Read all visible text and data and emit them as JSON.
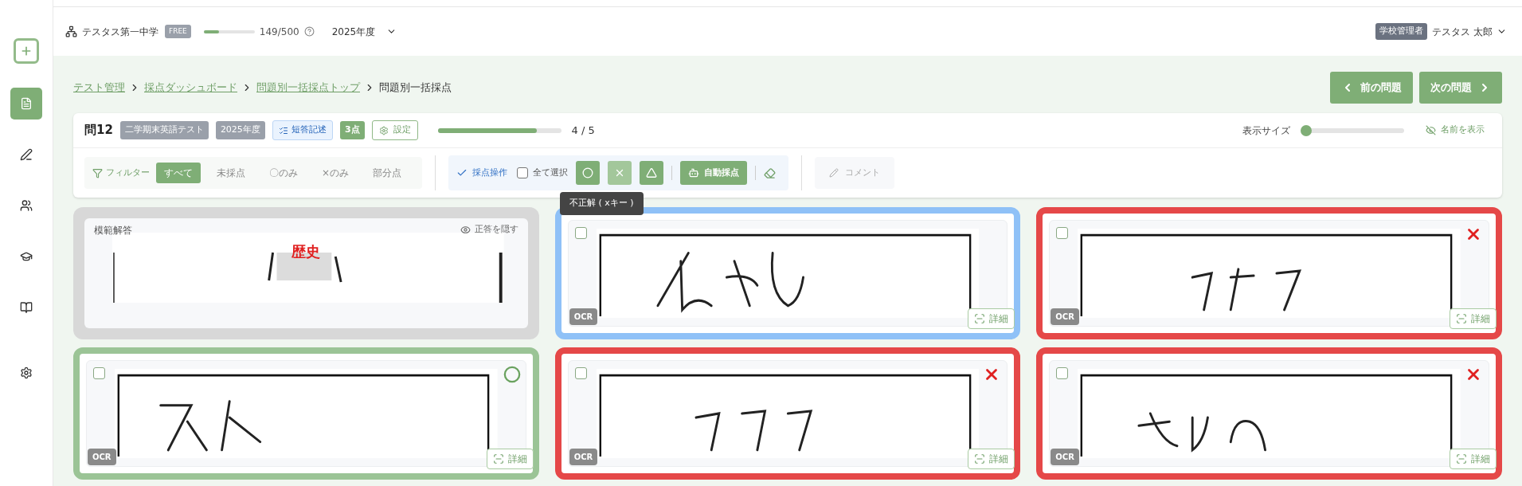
{
  "sidebar": {
    "add_button": {
      "selected": false
    },
    "items": [
      {
        "selected": true
      },
      {
        "selected": false
      },
      {
        "selected": false
      },
      {
        "selected": false
      },
      {
        "selected": false
      },
      {
        "selected": false
      }
    ]
  },
  "header": {
    "school": "テスタス第一中学",
    "plan": "FREE",
    "quota": {
      "level": 0.3,
      "reading": "149/500"
    },
    "year": "2025年度",
    "role": "学校管理者",
    "user": "テスタス 太郎"
  },
  "breadcrumbs": [
    {
      "label": "テスト管理",
      "link": true
    },
    {
      "label": "採点ダッシュボード",
      "link": true
    },
    {
      "label": "問題別一括採点トップ",
      "link": true
    },
    {
      "label": "問題別一括採点",
      "link": false
    }
  ],
  "nav_buttons": {
    "prev": "前の問題",
    "next": "次の問題"
  },
  "question": {
    "title": "問12",
    "tags": [
      "二学期末英語テスト",
      "2025年度"
    ],
    "type": "短答記述",
    "points": "3点",
    "settings": "設定",
    "progress": {
      "level": 0.8,
      "reading": "4 / 5"
    },
    "display_size": {
      "label": "表示サイズ",
      "level": 0
    },
    "show_names": "名前を表示"
  },
  "filter": {
    "label": "フィルター",
    "options": [
      {
        "label": "すべて",
        "selected": true
      },
      {
        "label": "未採点",
        "selected": false
      },
      {
        "label": "〇のみ",
        "selected": false
      },
      {
        "label": "×のみ",
        "selected": false
      },
      {
        "label": "部分点",
        "selected": false
      }
    ]
  },
  "grading": {
    "label": "採点操作",
    "select_all": {
      "label": "全て選択",
      "checked": false
    },
    "marks": [
      {
        "kind": "circle",
        "hovered": false
      },
      {
        "kind": "cross",
        "hovered": true,
        "tooltip": "不正解 ( xキー )"
      },
      {
        "kind": "triangle",
        "hovered": false
      }
    ],
    "auto": "自動採点",
    "comment": {
      "label": "コメント",
      "disabled": true
    }
  },
  "model_answer": {
    "label": "模範解答",
    "answer": "歴史",
    "hide": "正答を隠す"
  },
  "answers": [
    {
      "kind": "ungraded",
      "selected": true,
      "checked": false,
      "ocr": "OCR",
      "detail": "詳細"
    },
    {
      "kind": "wrong",
      "selected": false,
      "checked": false,
      "ocr": "OCR",
      "detail": "詳細"
    },
    {
      "kind": "correct",
      "selected": false,
      "checked": false,
      "ocr": "OCR",
      "detail": "詳細"
    },
    {
      "kind": "wrong",
      "selected": false,
      "checked": false,
      "ocr": "OCR",
      "detail": "詳細"
    },
    {
      "kind": "wrong",
      "selected": false,
      "checked": false,
      "ocr": "OCR",
      "detail": "詳細"
    }
  ]
}
